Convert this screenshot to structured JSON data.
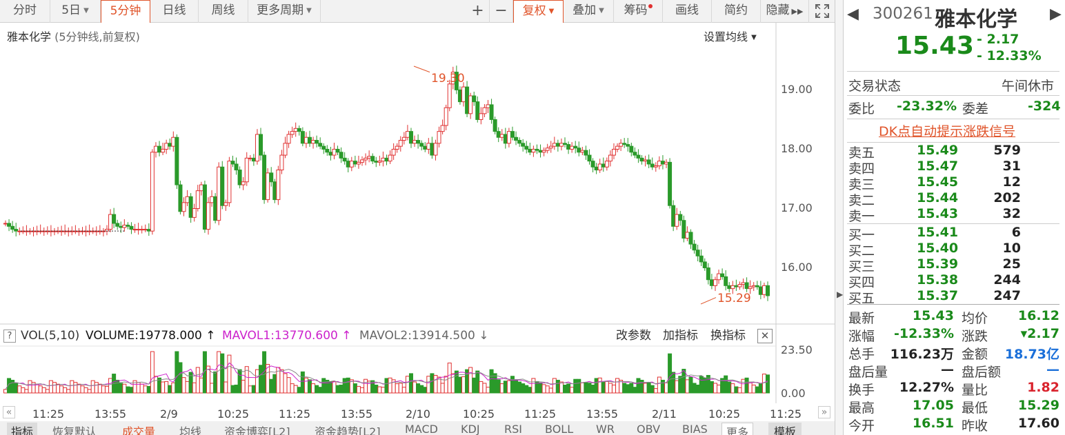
{
  "toolbar": {
    "tabs": [
      "分时",
      "5日",
      "5分钟",
      "日线",
      "周线",
      "更多周期"
    ],
    "icons": [
      "plus-icon",
      "minus-icon"
    ],
    "buttons": [
      "复权",
      "叠加",
      "筹码",
      "画线",
      "简约",
      "隐藏"
    ]
  },
  "chart": {
    "title": "雅本化学",
    "subtitle": "(5分钟线,前复权)",
    "ma_setting": "设置均线",
    "high_marker": "19.30",
    "low_marker": "15.29",
    "price_axis": [
      "19.00",
      "18.00",
      "17.00",
      "16.00"
    ],
    "vol_axis": [
      "23.50",
      "0.00"
    ]
  },
  "volume": {
    "help": "?",
    "name": "VOL(5,10)",
    "volume": "VOLUME:19778.000",
    "mavol1": "MAVOL1:13770.600",
    "mavol2": "MAVOL2:13914.500",
    "actions": [
      "改参数",
      "加指标",
      "换指标"
    ]
  },
  "x_axis": [
    "11:25",
    "13:55",
    "2/9",
    "10:25",
    "11:25",
    "13:55",
    "2/10",
    "10:25",
    "11:25",
    "13:55",
    "2/11",
    "10:25",
    "11:25"
  ],
  "bottom_tabs": [
    "指标",
    "恢复默认",
    "成交量",
    "均线",
    "资金博弈[L2]",
    "资金趋势[L2]",
    "MACD",
    "KDJ",
    "RSI",
    "BOLL",
    "WR",
    "OBV",
    "BIAS",
    "更多",
    "模板"
  ],
  "quote": {
    "code": "300261",
    "name": "雅本化学",
    "price": "15.43",
    "change": "- 2.17",
    "change_pct": "- 12.33%",
    "status_label": "交易状态",
    "status_value": "午间休市",
    "weibi_label": "委比",
    "weibi_value": "-23.32%",
    "weicha_label": "委差",
    "weicha_value": "-324",
    "signal_link": "DK点自动提示涨跌信号",
    "asks": [
      {
        "label": "卖五",
        "price": "15.49",
        "vol": "579"
      },
      {
        "label": "卖四",
        "price": "15.47",
        "vol": "31"
      },
      {
        "label": "卖三",
        "price": "15.45",
        "vol": "12"
      },
      {
        "label": "卖二",
        "price": "15.44",
        "vol": "202"
      },
      {
        "label": "卖一",
        "price": "15.43",
        "vol": "32"
      }
    ],
    "bids": [
      {
        "label": "买一",
        "price": "15.41",
        "vol": "6"
      },
      {
        "label": "买二",
        "price": "15.40",
        "vol": "10"
      },
      {
        "label": "买三",
        "price": "15.39",
        "vol": "25"
      },
      {
        "label": "买四",
        "price": "15.38",
        "vol": "244"
      },
      {
        "label": "买五",
        "price": "15.37",
        "vol": "247"
      }
    ],
    "stats": [
      {
        "l1": "最新",
        "v1": "15.43",
        "c1": "green",
        "l2": "均价",
        "v2": "16.12",
        "c2": "green"
      },
      {
        "l1": "涨幅",
        "v1": "-12.33%",
        "c1": "green",
        "l2": "涨跌",
        "v2": "▾2.17",
        "c2": "green"
      },
      {
        "l1": "总手",
        "v1": "116.23万",
        "c1": "dark",
        "l2": "金额",
        "v2": "18.73亿",
        "c2": "blue"
      },
      {
        "l1": "盘后量",
        "v1": "—",
        "c1": "dark",
        "l2": "盘后额",
        "v2": "—",
        "c2": "blue"
      },
      {
        "l1": "换手",
        "v1": "12.27%",
        "c1": "dark",
        "l2": "量比",
        "v2": "1.82",
        "c2": "red"
      },
      {
        "l1": "最高",
        "v1": "17.05",
        "c1": "green",
        "l2": "最低",
        "v2": "15.29",
        "c2": "green"
      },
      {
        "l1": "今开",
        "v1": "16.51",
        "c1": "green",
        "l2": "昨收",
        "v2": "17.60",
        "c2": "dark"
      }
    ]
  },
  "colors": {
    "up": "#e03030",
    "down": "#2a9a2a",
    "accent": "#e0542a",
    "mavol1": "#cc22cc",
    "mavol2": "#888888"
  },
  "chart_data": {
    "type": "candlestick",
    "title": "雅本化学 (5分钟线,前复权)",
    "ylim": [
      15.0,
      19.5
    ],
    "yticks": [
      19.0,
      18.0,
      17.0,
      16.0
    ],
    "high": 19.3,
    "low": 15.29,
    "close_series": [
      16.65,
      16.6,
      16.55,
      16.52,
      16.52,
      16.52,
      16.52,
      16.52,
      16.52,
      16.52,
      16.52,
      16.52,
      16.52,
      16.52,
      16.52,
      16.52,
      16.52,
      16.52,
      16.52,
      16.52,
      16.52,
      16.52,
      16.52,
      16.52,
      16.52,
      16.52,
      16.52,
      16.52,
      16.52,
      16.55,
      16.8,
      16.65,
      16.6,
      16.58,
      16.62,
      16.6,
      16.55,
      16.55,
      16.55,
      16.55,
      16.55,
      16.52,
      17.85,
      17.95,
      17.85,
      17.9,
      18.0,
      17.95,
      18.1,
      17.3,
      16.85,
      17.0,
      17.1,
      16.75,
      16.9,
      17.2,
      17.3,
      16.55,
      17.0,
      17.1,
      16.7,
      17.6,
      16.95,
      17.0,
      17.7,
      17.65,
      17.55,
      17.3,
      17.35,
      17.75,
      17.75,
      17.7,
      18.15,
      17.8,
      17.05,
      17.5,
      17.35,
      17.05,
      17.55,
      17.8,
      18.0,
      18.15,
      18.2,
      18.25,
      18.2,
      18.0,
      18.1,
      18.0,
      18.05,
      18.0,
      17.95,
      17.9,
      17.85,
      17.8,
      17.9,
      17.85,
      17.75,
      17.7,
      17.6,
      17.7,
      17.65,
      17.68,
      17.72,
      17.75,
      17.78,
      17.7,
      17.68,
      17.7,
      17.75,
      17.7,
      17.8,
      17.9,
      17.95,
      18.05,
      18.1,
      18.2,
      18.0,
      18.05,
      18.0,
      17.95,
      17.9,
      18.0,
      17.8,
      18.0,
      18.2,
      18.3,
      18.6,
      19.0,
      19.2,
      18.9,
      18.7,
      18.95,
      18.5,
      18.8,
      18.7,
      18.4,
      18.5,
      18.6,
      18.65,
      18.4,
      18.2,
      18.1,
      18.15,
      18.0,
      18.2,
      18.1,
      18.05,
      18.0,
      17.95,
      17.9,
      17.85,
      17.9,
      17.88,
      17.85,
      17.88,
      17.92,
      17.95,
      18.0,
      17.95,
      18.0,
      17.98,
      17.9,
      17.95,
      17.92,
      17.85,
      17.88,
      17.8,
      17.7,
      17.6,
      17.55,
      17.65,
      17.6,
      17.7,
      17.8,
      17.9,
      17.95,
      18.0,
      17.98,
      17.95,
      17.85,
      17.8,
      17.75,
      17.7,
      17.72,
      17.65,
      17.6,
      17.62,
      17.7,
      17.65,
      17.68,
      16.95,
      16.6,
      16.8,
      16.7,
      16.4,
      16.5,
      16.3,
      16.2,
      16.1,
      16.0,
      15.9,
      15.7,
      15.6,
      15.7,
      15.8,
      15.75,
      15.6,
      15.55,
      15.6,
      15.58,
      15.62,
      15.65,
      15.55,
      15.58,
      15.6,
      15.58,
      15.45,
      15.6,
      15.43
    ]
  }
}
